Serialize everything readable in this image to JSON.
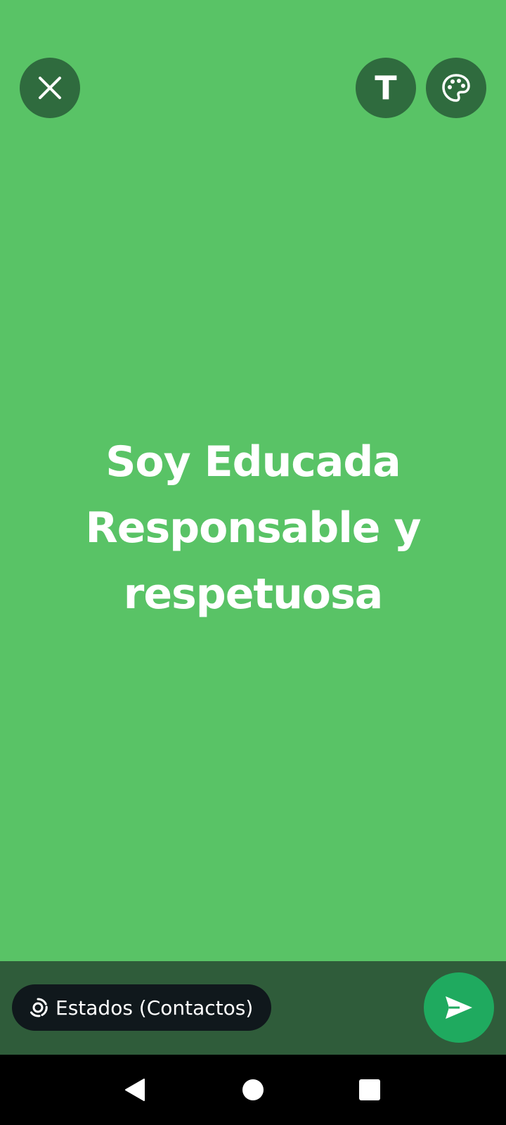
{
  "colors": {
    "canvas_background": "#59C366",
    "icon_button_background": "#2F6B3E",
    "bottom_bar_background": "#2F5C3A",
    "pill_background": "#10181C",
    "send_button_background": "#1FAA5F",
    "nav_bar_background": "#000000"
  },
  "toolbar": {
    "close_icon": "close-icon",
    "text_style_label": "T",
    "palette_icon": "palette-icon"
  },
  "status": {
    "lines": [
      "Soy Educada",
      "Responsable y",
      "respetuosa"
    ]
  },
  "bottom_bar": {
    "audience_icon": "status-ring-icon",
    "audience_label": "Estados (Contactos)",
    "send_icon": "send-icon"
  },
  "nav": {
    "back_icon": "back-triangle-icon",
    "home_icon": "home-circle-icon",
    "recents_icon": "recents-square-icon"
  }
}
